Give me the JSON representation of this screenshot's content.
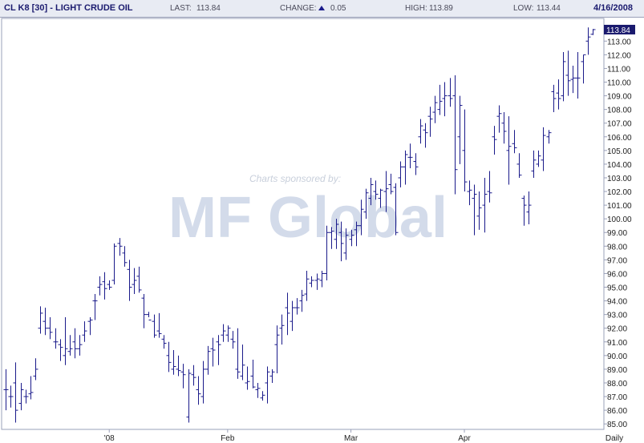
{
  "header": {
    "symbol": "CL K8 [30] - LIGHT CRUDE OIL",
    "last_label": "LAST:",
    "last_value": "113.84",
    "change_label": "CHANGE:",
    "change_value": "0.05",
    "high_label": "HIGH:",
    "high_value": "113.89",
    "low_label": "LOW:",
    "low_value": "113.44",
    "date": "4/16/2008"
  },
  "watermark": {
    "sponsor_text": "Charts sponsored by:",
    "logo_text": "MF Global"
  },
  "colors": {
    "bars": "#1a1a8a",
    "header_bg": "#e8ebf3",
    "last_price_box": "#1a1a6e",
    "watermark": "#cfd8e8"
  },
  "chart_data": {
    "type": "ohlc",
    "period_label": "Daily",
    "ylim": [
      84.6,
      114.6
    ],
    "y_ticks": [
      85,
      86,
      87,
      88,
      89,
      90,
      91,
      92,
      93,
      94,
      95,
      96,
      97,
      98,
      99,
      100,
      101,
      102,
      103,
      104,
      105,
      106,
      107,
      108,
      109,
      110,
      111,
      112,
      113
    ],
    "last_price_label": "113.84",
    "x_labels": [
      {
        "label": "'08",
        "index": 21
      },
      {
        "label": "Feb",
        "index": 45
      },
      {
        "label": "Mar",
        "index": 70
      },
      {
        "label": "Apr",
        "index": 93
      },
      {
        "label": "Daily",
        "index": 108
      }
    ],
    "ohlc": [
      [
        87.5,
        89.0,
        86.0,
        87.5
      ],
      [
        87.0,
        87.8,
        86.2,
        87.0
      ],
      [
        88.0,
        89.5,
        85.1,
        86.0
      ],
      [
        86.5,
        88.0,
        86.0,
        87.5
      ],
      [
        87.0,
        87.5,
        86.5,
        87.0
      ],
      [
        87.2,
        88.5,
        86.8,
        87.3
      ],
      [
        88.5,
        89.8,
        88.2,
        89.0
      ],
      [
        92.0,
        93.6,
        91.6,
        93.1
      ],
      [
        92.5,
        93.5,
        91.5,
        92.0
      ],
      [
        92.0,
        92.8,
        91.2,
        91.7
      ],
      [
        91.0,
        92.0,
        90.5,
        91.0
      ],
      [
        90.8,
        91.2,
        89.6,
        90.6
      ],
      [
        90.0,
        92.8,
        89.3,
        90.5
      ],
      [
        90.3,
        91.5,
        90.0,
        90.5
      ],
      [
        91.0,
        92.0,
        89.8,
        90.5
      ],
      [
        90.5,
        91.5,
        90.0,
        90.8
      ],
      [
        91.5,
        92.5,
        91.0,
        91.8
      ],
      [
        92.5,
        92.8,
        91.5,
        92.6
      ],
      [
        94.0,
        94.5,
        92.6,
        94.0
      ],
      [
        95.0,
        95.8,
        94.4,
        95.2
      ],
      [
        95.4,
        96.1,
        94.1,
        94.9
      ],
      [
        95.2,
        95.5,
        94.8,
        95.0
      ],
      [
        95.5,
        98.2,
        95.2,
        98.0
      ],
      [
        98.2,
        98.6,
        97.3,
        98.0
      ],
      [
        97.5,
        98.0,
        96.5,
        96.8
      ],
      [
        96.3,
        97.0,
        94.0,
        95.0
      ],
      [
        95.2,
        96.4,
        94.5,
        95.5
      ],
      [
        95.8,
        96.5,
        94.6,
        94.8
      ],
      [
        94.2,
        94.5,
        92.0,
        93.0
      ],
      [
        93.0,
        93.2,
        92.8,
        92.6
      ],
      [
        92.5,
        93.0,
        91.3,
        91.5
      ],
      [
        91.8,
        93.1,
        91.3,
        91.6
      ],
      [
        91.2,
        91.5,
        90.5,
        90.9
      ],
      [
        90.0,
        91.0,
        88.8,
        89.5
      ],
      [
        89.0,
        90.4,
        88.6,
        89.2
      ],
      [
        89.0,
        90.0,
        88.5,
        88.9
      ],
      [
        88.8,
        89.4,
        87.6,
        88.6
      ],
      [
        85.5,
        89.0,
        85.1,
        88.7
      ],
      [
        88.6,
        89.3,
        87.8,
        88.4
      ],
      [
        87.5,
        88.5,
        86.4,
        87.2
      ],
      [
        87.0,
        89.6,
        86.5,
        89.0
      ],
      [
        89.0,
        90.7,
        88.6,
        90.3
      ],
      [
        90.5,
        91.3,
        89.2,
        90.4
      ],
      [
        91.0,
        91.5,
        89.3,
        90.8
      ],
      [
        91.5,
        92.3,
        91.0,
        91.8
      ],
      [
        91.5,
        92.2,
        91.0,
        92.0
      ],
      [
        91.2,
        91.8,
        90.5,
        91.0
      ],
      [
        89.0,
        92.0,
        88.3,
        88.8
      ],
      [
        88.5,
        90.8,
        88.2,
        89.3
      ],
      [
        88.0,
        89.2,
        87.5,
        88.1
      ],
      [
        88.5,
        89.7,
        87.6,
        87.7
      ],
      [
        87.5,
        88.0,
        86.9,
        87.6
      ],
      [
        86.9,
        87.4,
        86.7,
        87.1
      ],
      [
        88.0,
        89.2,
        86.5,
        88.8
      ],
      [
        88.5,
        89.0,
        88.0,
        88.8
      ],
      [
        90.8,
        92.2,
        88.7,
        91.5
      ],
      [
        92.0,
        93.0,
        90.8,
        92.2
      ],
      [
        93.5,
        94.6,
        91.5,
        93.1
      ],
      [
        92.5,
        94.0,
        91.8,
        93.5
      ],
      [
        93.5,
        94.2,
        93.0,
        93.5
      ],
      [
        94.0,
        94.8,
        93.2,
        94.4
      ],
      [
        94.5,
        96.2,
        94.0,
        95.6
      ],
      [
        95.3,
        95.8,
        95.0,
        95.5
      ],
      [
        95.5,
        96.0,
        94.8,
        95.6
      ],
      [
        95.5,
        96.2,
        95.0,
        96.0
      ],
      [
        96.0,
        99.5,
        95.5,
        99.0
      ],
      [
        99.0,
        99.4,
        97.8,
        99.1
      ],
      [
        98.5,
        100.0,
        97.8,
        99.6
      ],
      [
        99.0,
        99.8,
        96.9,
        98.2
      ],
      [
        97.5,
        99.3,
        97.0,
        98.8
      ],
      [
        98.5,
        99.2,
        98.0,
        98.8
      ],
      [
        99.2,
        99.8,
        98.0,
        99.5
      ],
      [
        99.5,
        101.4,
        98.8,
        100.7
      ],
      [
        100.5,
        102.2,
        100.0,
        101.9
      ],
      [
        101.5,
        103.0,
        101.0,
        102.5
      ],
      [
        102.0,
        102.8,
        101.4,
        101.8
      ],
      [
        101.5,
        102.2,
        100.8,
        102.1
      ],
      [
        102.0,
        103.5,
        100.5,
        102.2
      ],
      [
        102.5,
        103.3,
        101.8,
        102.0
      ],
      [
        102.3,
        102.6,
        98.8,
        99.0
      ],
      [
        103.0,
        104.2,
        102.3,
        103.8
      ],
      [
        103.8,
        105.0,
        102.5,
        104.7
      ],
      [
        104.5,
        105.5,
        103.7,
        104.5
      ],
      [
        104.2,
        104.8,
        103.2,
        103.8
      ],
      [
        106.0,
        107.3,
        105.5,
        106.8
      ],
      [
        106.5,
        107.0,
        105.2,
        106.3
      ],
      [
        107.5,
        108.2,
        106.0,
        107.3
      ],
      [
        107.8,
        109.0,
        107.0,
        108.5
      ],
      [
        108.0,
        109.8,
        107.6,
        108.6
      ],
      [
        108.8,
        110.0,
        107.5,
        109.0
      ],
      [
        109.0,
        110.3,
        108.2,
        108.8
      ],
      [
        109.0,
        110.5,
        101.8,
        103.6
      ],
      [
        106.0,
        109.0,
        104.0,
        108.3
      ],
      [
        105.0,
        108.0,
        102.0,
        102.7
      ],
      [
        102.0,
        102.8,
        101.0,
        102.1
      ],
      [
        101.5,
        102.5,
        98.8,
        101.8
      ],
      [
        100.2,
        102.0,
        99.2,
        100.8
      ],
      [
        101.0,
        103.0,
        99.0,
        101.8
      ],
      [
        102.0,
        103.5,
        101.2,
        101.9
      ],
      [
        106.0,
        106.8,
        104.7,
        105.8
      ],
      [
        107.5,
        108.3,
        106.3,
        107.7
      ],
      [
        107.0,
        107.8,
        105.5,
        106.4
      ],
      [
        105.0,
        107.5,
        102.5,
        105.3
      ],
      [
        105.5,
        106.5,
        104.8,
        105.2
      ],
      [
        104.0,
        104.8,
        103.0,
        103.2
      ],
      [
        101.5,
        101.7,
        99.5,
        101.0
      ],
      [
        100.5,
        102.0,
        99.6,
        101.0
      ],
      [
        103.5,
        105.0,
        103.0,
        104.3
      ],
      [
        104.0,
        105.0,
        103.8,
        104.6
      ],
      [
        104.3,
        106.7,
        103.5,
        106.1
      ],
      [
        106.0,
        106.5,
        105.5,
        106.3
      ],
      [
        109.3,
        109.8,
        107.8,
        108.8
      ],
      [
        109.2,
        110.2,
        108.0,
        108.8
      ],
      [
        109.0,
        112.2,
        108.6,
        111.5
      ],
      [
        110.5,
        112.3,
        109.0,
        110.1
      ],
      [
        110.2,
        111.2,
        109.2,
        110.3
      ],
      [
        110.3,
        112.2,
        108.8,
        110.3
      ],
      [
        111.5,
        112.0,
        109.9,
        112.0
      ],
      [
        113.0,
        114.0,
        112.0,
        113.3
      ],
      [
        113.5,
        113.89,
        113.44,
        113.84
      ]
    ]
  }
}
